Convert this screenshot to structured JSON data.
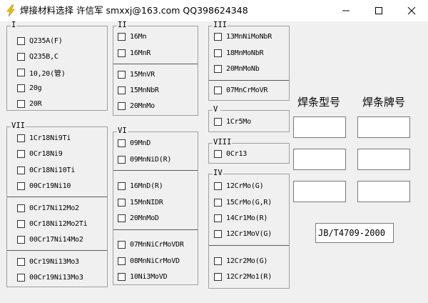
{
  "window": {
    "title": "焊接材料选择   许信军  smxxj@163.com   QQ398624348",
    "icon": "lightning-icon",
    "minimize": "─",
    "maximize": "☐",
    "close": "✕"
  },
  "labels": {
    "type_number": "焊条型号",
    "brand_number": "焊条牌号",
    "standard": "JB/T4709-2000"
  },
  "groups": {
    "g1": {
      "legend": "I",
      "items": [
        "Q235A(F)",
        "Q235B,C",
        "10,20(管)",
        "20g",
        "20R"
      ]
    },
    "g2": {
      "legend": "II",
      "items": [
        "16Mn",
        "16MnR",
        "15MnVR",
        "15MnNbR",
        "20MnMo"
      ]
    },
    "g3": {
      "legend": "III",
      "items": [
        "13MnNiMoNbR",
        "18MnMoNbR",
        "20MnMoNb",
        "07MnCrMoVR"
      ]
    },
    "g5": {
      "legend": "V",
      "items": [
        "1Cr5Mo"
      ]
    },
    "g8": {
      "legend": "VIII",
      "items": [
        "0Cr13"
      ]
    },
    "g4": {
      "legend": "IV",
      "items": [
        "12CrMo(G)",
        "15CrMo(G,R)",
        "14Cr1Mo(R)",
        "12Cr1MoV(G)",
        "12Cr2Mo(G)",
        "12Cr2Mo1(R)"
      ]
    },
    "g6": {
      "legend": "VI",
      "items": [
        "09MnD",
        "09MnNiD(R)",
        "16MnD(R)",
        "15MnNIDR",
        "20MnMoD",
        "07MnNiCrMoVDR",
        "08MnNiCrMoVD",
        "10Ni3MoVD"
      ]
    },
    "g7": {
      "legend": "VII",
      "items": [
        "1Cr18Ni9Ti",
        "0Cr18Ni9",
        "0Cr18Ni10Ti",
        "00Cr19Ni10",
        "0Cr17Ni12Mo2",
        "0Cr18Ni12Mo2Ti",
        "00Cr17Ni14Mo2",
        "0Cr19Ni13Mo3",
        "00Cr19Ni13Mo3"
      ]
    }
  }
}
